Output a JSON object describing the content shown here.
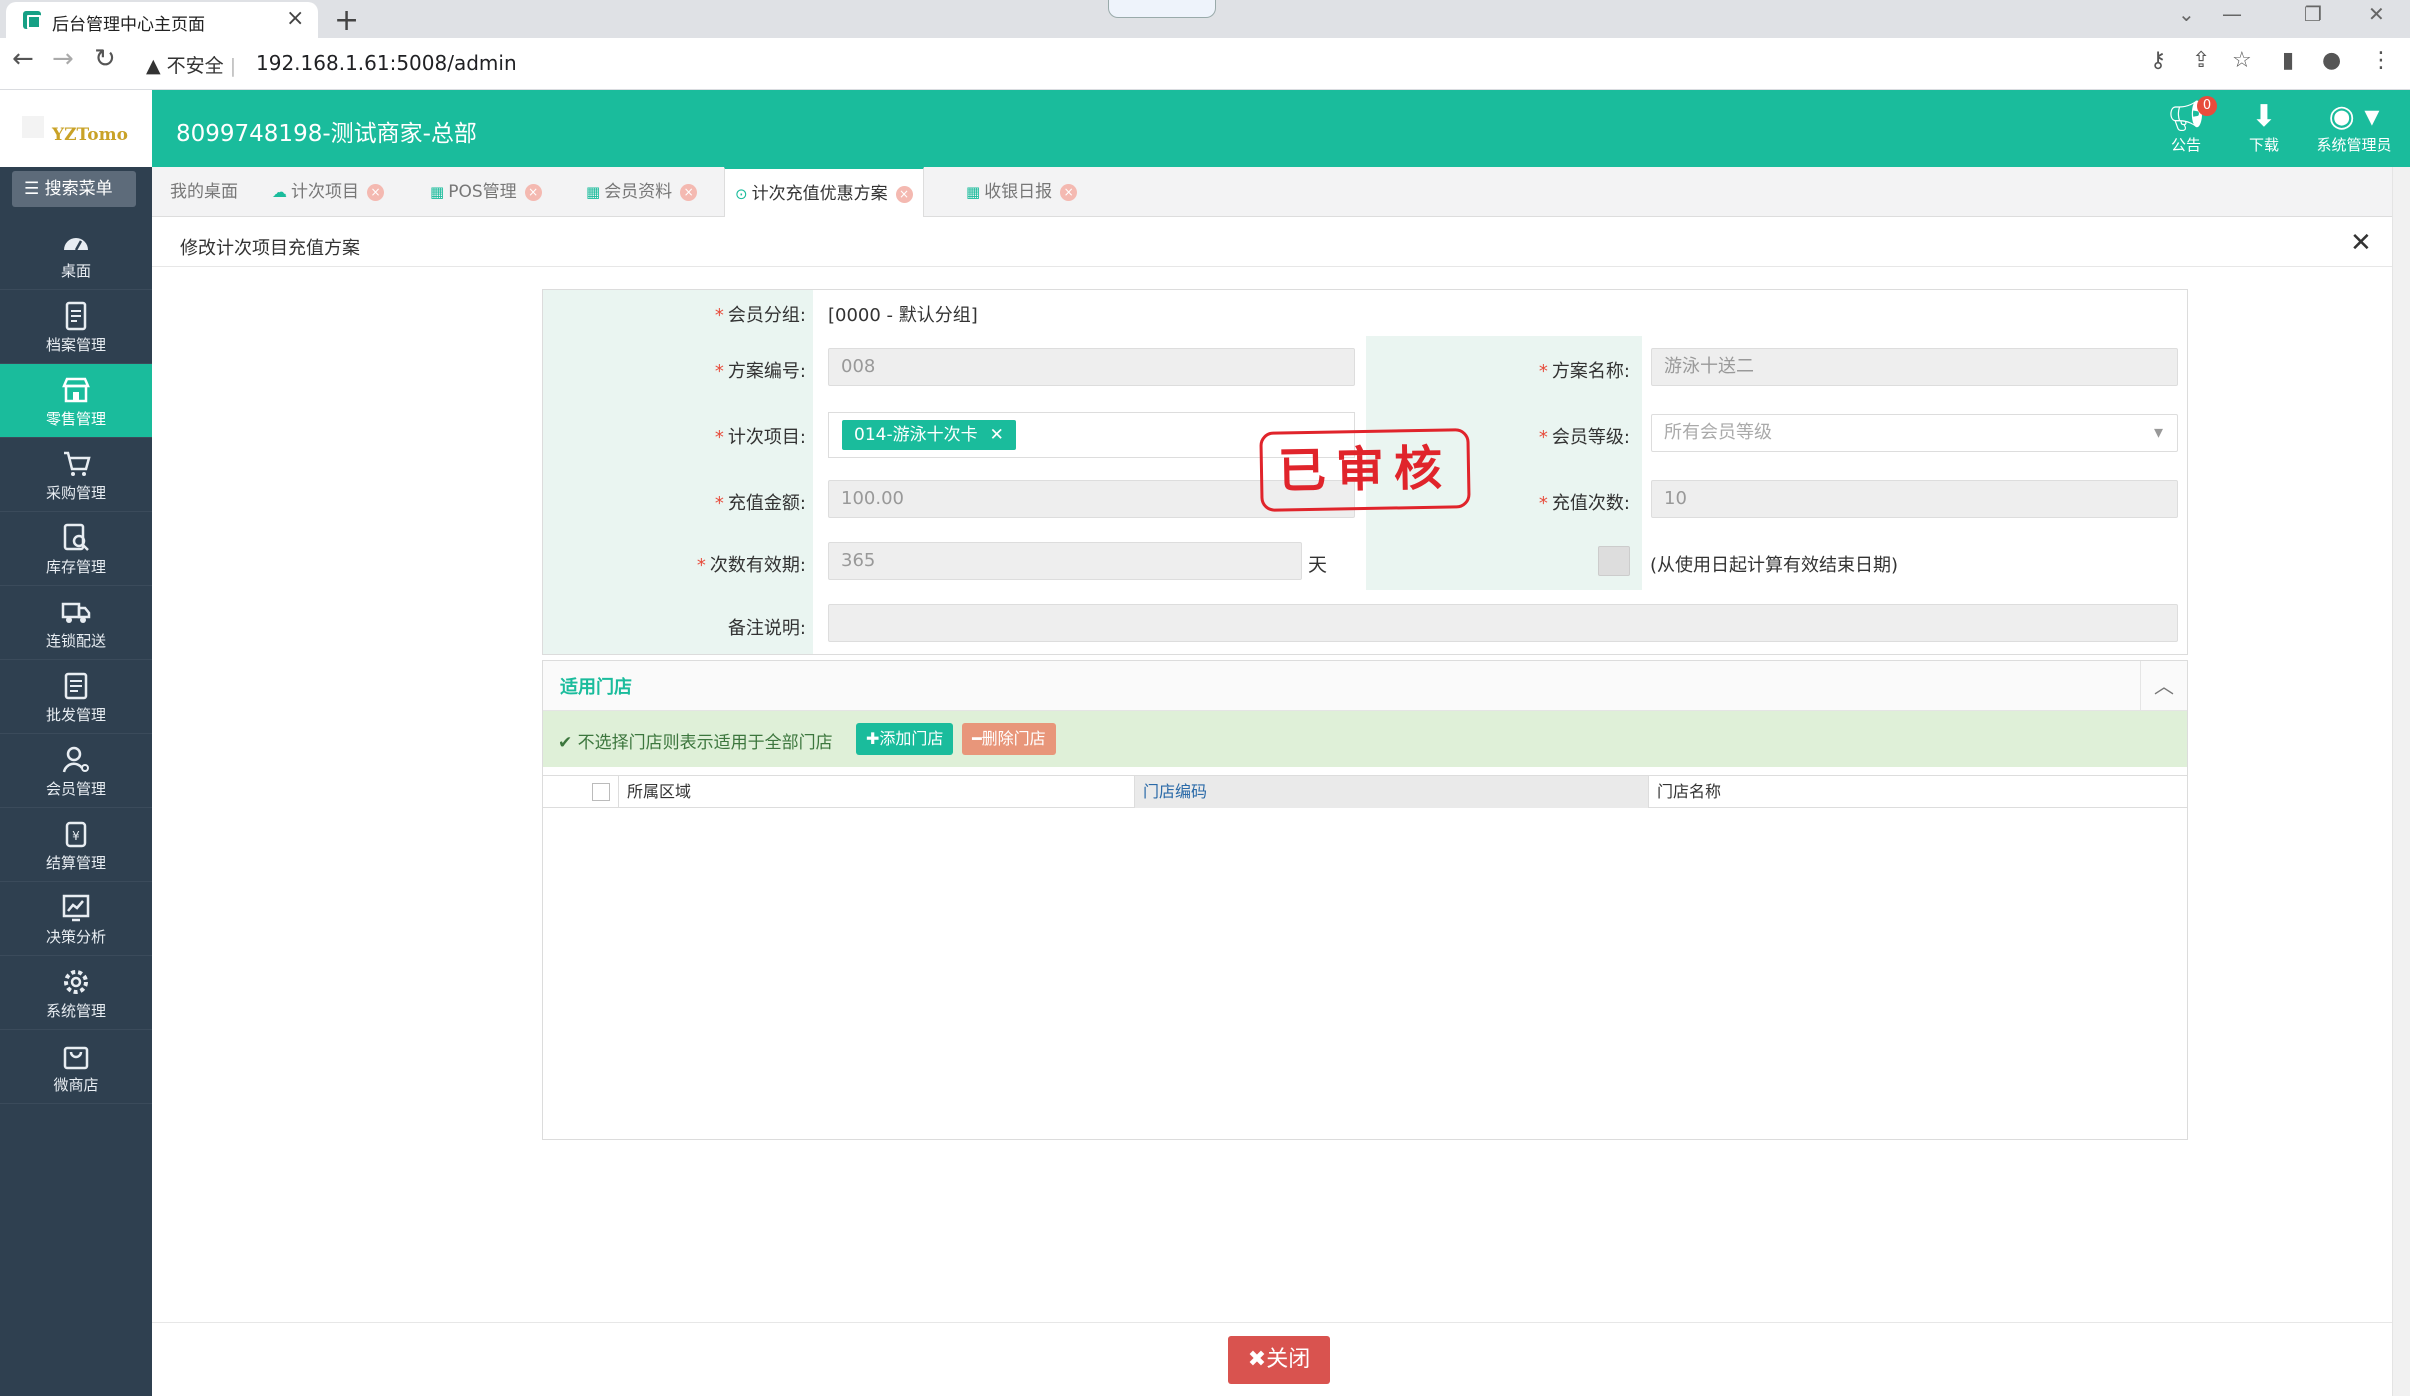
{
  "browser": {
    "tab_title": "后台管理中心主页面",
    "insecure_label": "不安全",
    "url": "192.168.1.61:5008/admin"
  },
  "header": {
    "logo_text": "YZTomo",
    "merchant": "8099748198-测试商家-总部",
    "notice_label": "公告",
    "notice_count": "0",
    "download_label": "下载",
    "user_label": "系统管理员"
  },
  "sidebar": {
    "search_label": "搜索菜单",
    "items": [
      {
        "label": "桌面",
        "icon": "dashboard-icon"
      },
      {
        "label": "档案管理",
        "icon": "file-icon"
      },
      {
        "label": "零售管理",
        "icon": "store-icon"
      },
      {
        "label": "采购管理",
        "icon": "cart-icon"
      },
      {
        "label": "库存管理",
        "icon": "inventory-icon"
      },
      {
        "label": "连锁配送",
        "icon": "truck-icon"
      },
      {
        "label": "批发管理",
        "icon": "wholesale-icon"
      },
      {
        "label": "会员管理",
        "icon": "member-icon"
      },
      {
        "label": "结算管理",
        "icon": "settlement-icon"
      },
      {
        "label": "决策分析",
        "icon": "chart-icon"
      },
      {
        "label": "系统管理",
        "icon": "gear-icon"
      },
      {
        "label": "微商店",
        "icon": "bag-icon"
      }
    ]
  },
  "tabs": [
    {
      "label": "我的桌面"
    },
    {
      "label": "计次项目"
    },
    {
      "label": "POS管理"
    },
    {
      "label": "会员资料"
    },
    {
      "label": "计次充值优惠方案"
    },
    {
      "label": "收银日报"
    }
  ],
  "page": {
    "title": "修改计次项目充值方案"
  },
  "form": {
    "group_label": "会员分组:",
    "group_value": "[0000 - 默认分组]",
    "code_label": "方案编号:",
    "code_value": "008",
    "name_label": "方案名称:",
    "name_value": "游泳十送二",
    "item_label": "计次项目:",
    "item_chip": "014-游泳十次卡",
    "level_label": "会员等级:",
    "level_placeholder": "所有会员等级",
    "amount_label": "充值金额:",
    "amount_value": "100.00",
    "count_label": "充值次数:",
    "count_value": "10",
    "validity_label": "次数有效期:",
    "validity_value": "365",
    "validity_unit": "天",
    "from_first_use_label": "(从使用日起计算有效结束日期)",
    "remark_label": "备注说明:",
    "remark_value": "",
    "stamp": "已审核"
  },
  "stores": {
    "title": "适用门店",
    "tip": "不选择门店则表示适用于全部门店",
    "add_button": "添加门店",
    "delete_button": "删除门店",
    "columns": [
      "所属区域",
      "门店编码",
      "门店名称"
    ],
    "rows": []
  },
  "footer": {
    "close_button": "关闭"
  },
  "colors": {
    "accent": "#1abc9c",
    "sidebar": "#2f4050",
    "danger": "#d9534f"
  }
}
